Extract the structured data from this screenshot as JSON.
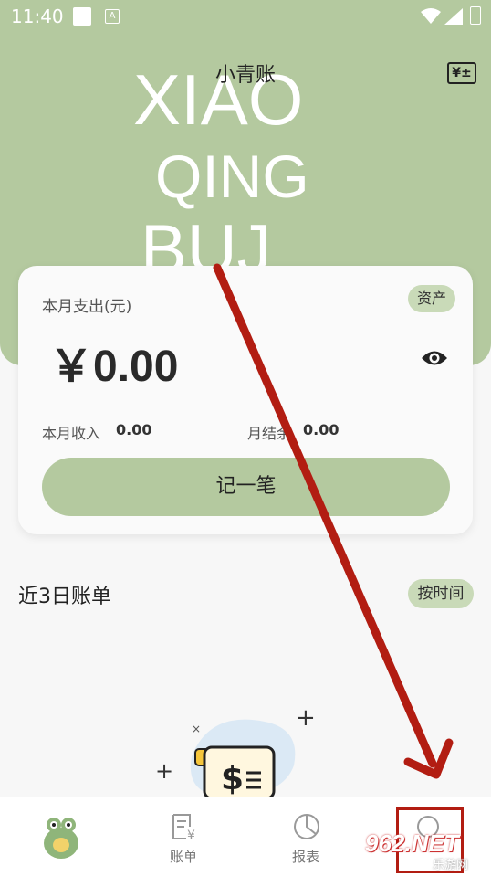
{
  "status_bar": {
    "time": "11:40",
    "notif_icon": "a-icon"
  },
  "header": {
    "title": "小青账",
    "calc_icon": "¥±",
    "big_text": [
      "XIAO",
      "QING",
      "BUJ"
    ]
  },
  "summary_card": {
    "expense_label": "本月支出(元)",
    "asset_badge": "资产",
    "amount": "￥0.00",
    "income_label": "本月收入",
    "income_value": "0.00",
    "balance_label": "月结余",
    "balance_value": "0.00",
    "record_button": "记一笔"
  },
  "recent": {
    "title": "近3日账单",
    "sort_button": "按时间"
  },
  "tabbar": {
    "items": [
      {
        "label": "",
        "icon": "turtle-mascot-icon"
      },
      {
        "label": "账单",
        "icon": "bill-icon"
      },
      {
        "label": "报表",
        "icon": "pie-chart-icon"
      },
      {
        "label": "",
        "icon": "profile-icon"
      }
    ]
  },
  "watermark": {
    "logo": "962.NET",
    "sub": "乐游网"
  },
  "colors": {
    "accent": "#b4c99f",
    "badge": "#c9dab8",
    "arrow": "#b21d12"
  }
}
